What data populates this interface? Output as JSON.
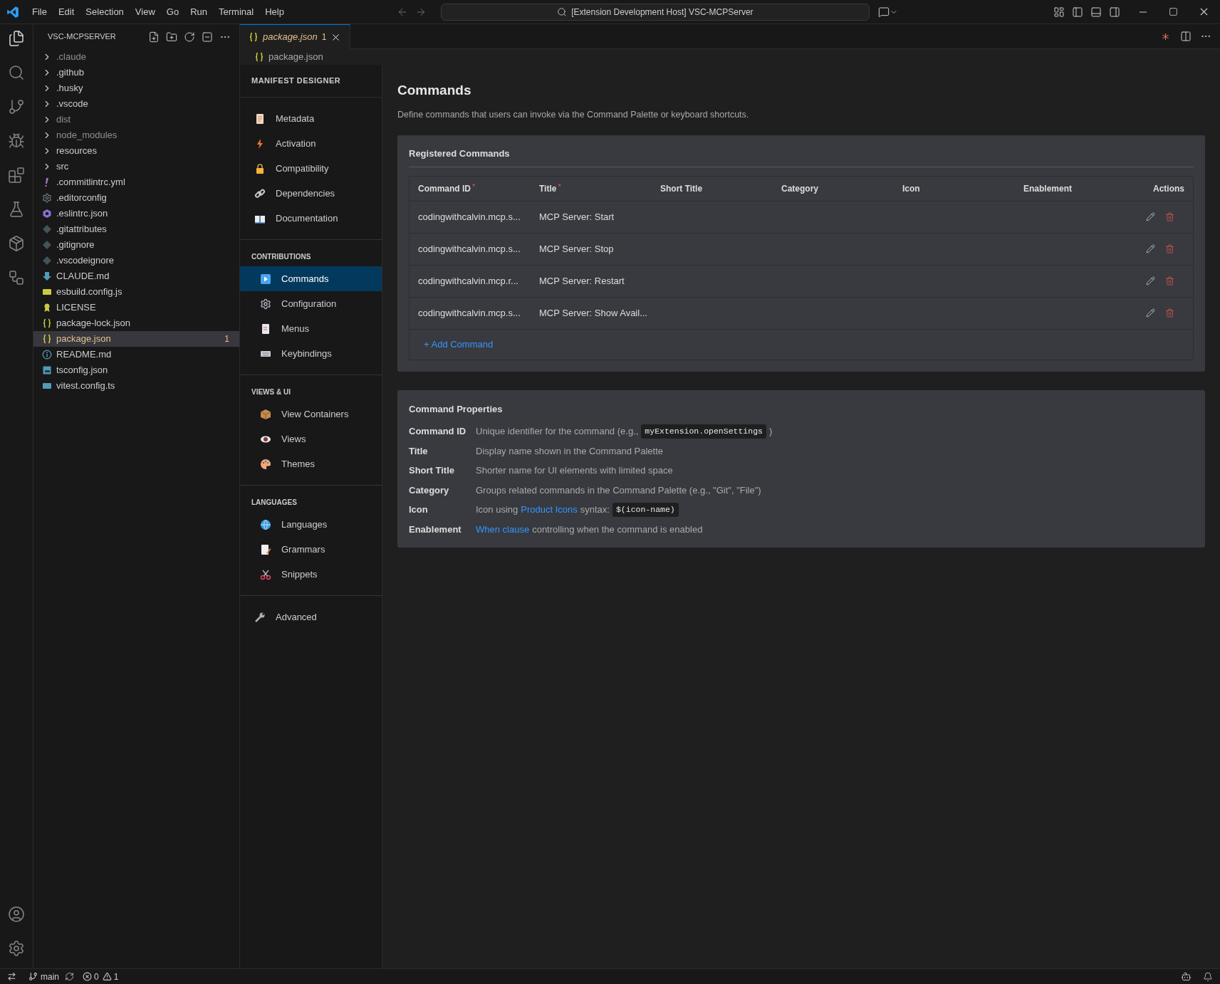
{
  "menu": [
    "File",
    "Edit",
    "Selection",
    "View",
    "Go",
    "Run",
    "Terminal",
    "Help"
  ],
  "command_center": "[Extension Development Host] VSC-MCPServer",
  "explorer": {
    "title": "VSC-MCPSERVER",
    "items": [
      {
        "name": ".claude",
        "kind": "folder",
        "dimmed": true,
        "selected": false
      },
      {
        "name": ".github",
        "kind": "folder",
        "dimmed": false,
        "selected": false
      },
      {
        "name": ".husky",
        "kind": "folder",
        "dimmed": false,
        "selected": false
      },
      {
        "name": ".vscode",
        "kind": "folder",
        "dimmed": false,
        "selected": false
      },
      {
        "name": "dist",
        "kind": "folder",
        "dimmed": true,
        "selected": false
      },
      {
        "name": "node_modules",
        "kind": "folder",
        "dimmed": true,
        "selected": false
      },
      {
        "name": "resources",
        "kind": "folder",
        "dimmed": false,
        "selected": false
      },
      {
        "name": "src",
        "kind": "folder",
        "dimmed": false,
        "selected": false
      },
      {
        "name": ".commitlintrc.yml",
        "kind": "yaml",
        "dimmed": false,
        "selected": false
      },
      {
        "name": ".editorconfig",
        "kind": "gear",
        "dimmed": false,
        "selected": false
      },
      {
        "name": ".eslintrc.json",
        "kind": "eslint",
        "dimmed": false,
        "selected": false
      },
      {
        "name": ".gitattributes",
        "kind": "git",
        "dimmed": false,
        "selected": false
      },
      {
        "name": ".gitignore",
        "kind": "git",
        "dimmed": false,
        "selected": false
      },
      {
        "name": ".vscodeignore",
        "kind": "git",
        "dimmed": false,
        "selected": false
      },
      {
        "name": "CLAUDE.md",
        "kind": "markdown",
        "dimmed": false,
        "selected": false
      },
      {
        "name": "esbuild.config.js",
        "kind": "js",
        "dimmed": false,
        "selected": false
      },
      {
        "name": "LICENSE",
        "kind": "license",
        "dimmed": false,
        "selected": false
      },
      {
        "name": "package-lock.json",
        "kind": "json",
        "dimmed": false,
        "selected": false
      },
      {
        "name": "package.json",
        "kind": "json",
        "dimmed": false,
        "selected": true,
        "badge": "1"
      },
      {
        "name": "README.md",
        "kind": "info",
        "dimmed": false,
        "selected": false
      },
      {
        "name": "tsconfig.json",
        "kind": "tsconfig",
        "dimmed": false,
        "selected": false
      },
      {
        "name": "vitest.config.ts",
        "kind": "ts",
        "dimmed": false,
        "selected": false
      }
    ]
  },
  "tab": {
    "label": "package.json",
    "badge": "1"
  },
  "breadcrumb": "package.json",
  "designer": {
    "title": "MANIFEST DESIGNER",
    "groups": [
      {
        "items": [
          {
            "label": "Metadata",
            "kind": "page",
            "selected": false
          },
          {
            "label": "Activation",
            "kind": "bolt",
            "selected": false
          },
          {
            "label": "Compatibility",
            "kind": "lock",
            "selected": false
          },
          {
            "label": "Dependencies",
            "kind": "link",
            "selected": false
          },
          {
            "label": "Documentation",
            "kind": "book",
            "selected": false
          }
        ]
      },
      {
        "heading": "CONTRIBUTIONS",
        "items": [
          {
            "label": "Commands",
            "kind": "play",
            "selected": true
          },
          {
            "label": "Configuration",
            "kind": "gear",
            "selected": false
          },
          {
            "label": "Menus",
            "kind": "menu",
            "selected": false
          },
          {
            "label": "Keybindings",
            "kind": "keyboard",
            "selected": false
          }
        ]
      },
      {
        "heading": "VIEWS & UI",
        "items": [
          {
            "label": "View Containers",
            "kind": "box",
            "selected": false
          },
          {
            "label": "Views",
            "kind": "eye",
            "selected": false
          },
          {
            "label": "Themes",
            "kind": "palette",
            "selected": false
          }
        ]
      },
      {
        "heading": "LANGUAGES",
        "items": [
          {
            "label": "Languages",
            "kind": "globe",
            "selected": false
          },
          {
            "label": "Grammars",
            "kind": "memo",
            "selected": false
          },
          {
            "label": "Snippets",
            "kind": "scissors",
            "selected": false
          }
        ]
      },
      {
        "items": [
          {
            "label": "Advanced",
            "kind": "wrench",
            "selected": false
          }
        ]
      }
    ]
  },
  "page": {
    "title": "Commands",
    "description": "Define commands that users can invoke via the Command Palette or keyboard shortcuts."
  },
  "registered": {
    "title": "Registered Commands",
    "columns": [
      {
        "label": "Command ID",
        "marker": "*"
      },
      {
        "label": "Title",
        "marker": "*"
      },
      {
        "label": "Short Title"
      },
      {
        "label": "Category"
      },
      {
        "label": "Icon"
      },
      {
        "label": "Enablement"
      },
      {
        "label": "Actions"
      }
    ],
    "rows": [
      {
        "id": "codingwithcalvin.mcp.s...",
        "title": "MCP Server: Start"
      },
      {
        "id": "codingwithcalvin.mcp.s...",
        "title": "MCP Server: Stop"
      },
      {
        "id": "codingwithcalvin.mcp.r...",
        "title": "MCP Server: Restart"
      },
      {
        "id": "codingwithcalvin.mcp.s...",
        "title": "MCP Server: Show Avail..."
      }
    ],
    "add": "+ Add Command"
  },
  "properties": {
    "title": "Command Properties",
    "rows": [
      {
        "term": "Command ID",
        "parts": [
          {
            "kind": "text",
            "text": "Unique identifier for the command (e.g.,"
          },
          {
            "kind": "code",
            "text": "myExtension.openSettings"
          },
          {
            "kind": "text",
            "text": ")"
          }
        ]
      },
      {
        "term": "Title",
        "parts": [
          {
            "kind": "text",
            "text": "Display name shown in the Command Palette"
          }
        ]
      },
      {
        "term": "Short Title",
        "parts": [
          {
            "kind": "text",
            "text": "Shorter name for UI elements with limited space"
          }
        ]
      },
      {
        "term": "Category",
        "parts": [
          {
            "kind": "text",
            "text": "Groups related commands in the Command Palette (e.g., \"Git\", \"File\")"
          }
        ]
      },
      {
        "term": "Icon",
        "parts": [
          {
            "kind": "text",
            "text": "Icon using"
          },
          {
            "kind": "link",
            "text": "Product Icons"
          },
          {
            "kind": "text",
            "text": "syntax:"
          },
          {
            "kind": "code",
            "text": "$(icon-name)"
          }
        ]
      },
      {
        "term": "Enablement",
        "parts": [
          {
            "kind": "link",
            "text": "When clause"
          },
          {
            "kind": "text",
            "text": "controlling when the command is enabled"
          }
        ]
      }
    ]
  },
  "status": {
    "branch": "main",
    "errors": "0",
    "warnings": "1"
  }
}
